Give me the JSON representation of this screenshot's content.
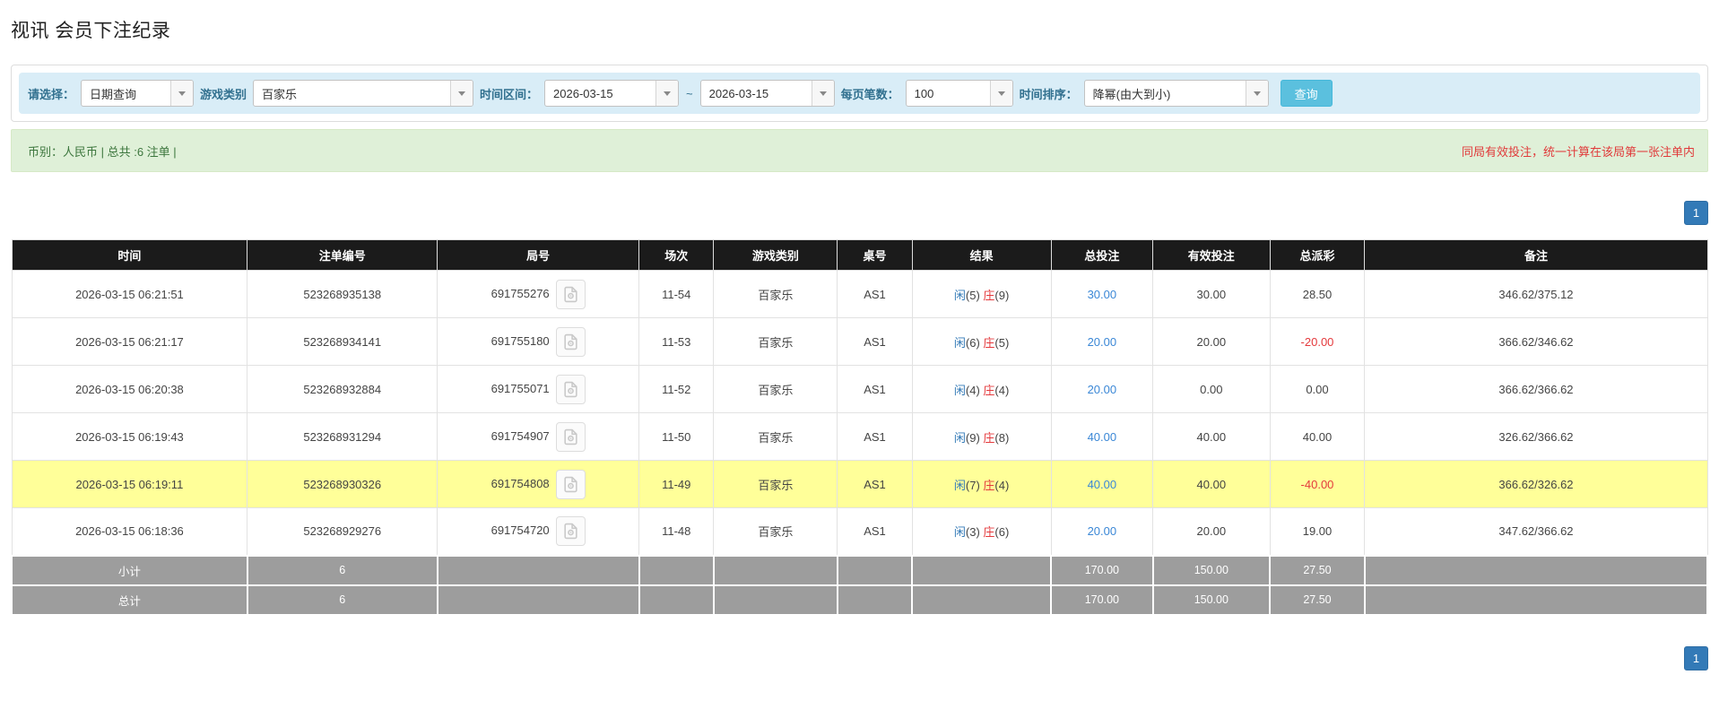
{
  "page": {
    "title": "视讯 会员下注纪录"
  },
  "filters": {
    "select_label": "请选择：",
    "select_value": "日期查询",
    "game_type_label": "游戏类别",
    "game_type_value": "百家乐",
    "time_range_label": "时间区间：",
    "date_from": "2026-03-15",
    "tilde": "~",
    "date_to": "2026-03-15",
    "page_size_label": "每页笔数：",
    "page_size_value": "100",
    "sort_label": "时间排序：",
    "sort_value": "降幂(由大到小)",
    "search_button": "查询"
  },
  "summary": {
    "left": "币别：人民币 | 总共 :6 注单 |",
    "right": "同局有效投注，统一计算在该局第一张注单内"
  },
  "pagination": {
    "page": "1"
  },
  "icons": {
    "combo_arrow": "caret-down-icon",
    "round_cell_icon": "video-file-icon"
  },
  "colors": {
    "filter_bar_bg": "#d9edf7",
    "filter_label": "#31708f",
    "query_button": "#5bc0de",
    "summary_bg": "#dff0d8",
    "summary_text": "#3c763d",
    "notice_red": "#e03a3a",
    "header_bg": "#1b1b1b",
    "highlight_yellow": "#ffff99",
    "player_blue": "#337ab7",
    "banker_red": "#e4393c",
    "link_blue": "#3a87d6",
    "negative_red": "#e4393c",
    "footer_gray": "#9d9d9d",
    "pager_blue": "#337ab7"
  },
  "table": {
    "headers": [
      "时间",
      "注单编号",
      "局号",
      "场次",
      "游戏类别",
      "桌号",
      "结果",
      "总投注",
      "有效投注",
      "总派彩",
      "备注"
    ],
    "rows": [
      {
        "time": "2026-03-15 06:21:51",
        "bet_id": "523268935138",
        "round": "691755276",
        "session": "11-54",
        "game": "百家乐",
        "table_no": "AS1",
        "result": {
          "player": "闲",
          "player_score": "(5)",
          "banker": "庄",
          "banker_score": "(9)"
        },
        "total_bet": "30.00",
        "valid_bet": "30.00",
        "payout": "28.50",
        "remark": "346.62/375.12",
        "highlight": false
      },
      {
        "time": "2026-03-15 06:21:17",
        "bet_id": "523268934141",
        "round": "691755180",
        "session": "11-53",
        "game": "百家乐",
        "table_no": "AS1",
        "result": {
          "player": "闲",
          "player_score": "(6)",
          "banker": "庄",
          "banker_score": "(5)"
        },
        "total_bet": "20.00",
        "valid_bet": "20.00",
        "payout": "-20.00",
        "remark": "366.62/346.62",
        "highlight": false
      },
      {
        "time": "2026-03-15 06:20:38",
        "bet_id": "523268932884",
        "round": "691755071",
        "session": "11-52",
        "game": "百家乐",
        "table_no": "AS1",
        "result": {
          "player": "闲",
          "player_score": "(4)",
          "banker": "庄",
          "banker_score": "(4)"
        },
        "total_bet": "20.00",
        "valid_bet": "0.00",
        "payout": "0.00",
        "remark": "366.62/366.62",
        "highlight": false
      },
      {
        "time": "2026-03-15 06:19:43",
        "bet_id": "523268931294",
        "round": "691754907",
        "session": "11-50",
        "game": "百家乐",
        "table_no": "AS1",
        "result": {
          "player": "闲",
          "player_score": "(9)",
          "banker": "庄",
          "banker_score": "(8)"
        },
        "total_bet": "40.00",
        "valid_bet": "40.00",
        "payout": "40.00",
        "remark": "326.62/366.62",
        "highlight": false
      },
      {
        "time": "2026-03-15 06:19:11",
        "bet_id": "523268930326",
        "round": "691754808",
        "session": "11-49",
        "game": "百家乐",
        "table_no": "AS1",
        "result": {
          "player": "闲",
          "player_score": "(7)",
          "banker": "庄",
          "banker_score": "(4)"
        },
        "total_bet": "40.00",
        "valid_bet": "40.00",
        "payout": "-40.00",
        "remark": "366.62/326.62",
        "highlight": true
      },
      {
        "time": "2026-03-15 06:18:36",
        "bet_id": "523268929276",
        "round": "691754720",
        "session": "11-48",
        "game": "百家乐",
        "table_no": "AS1",
        "result": {
          "player": "闲",
          "player_score": "(3)",
          "banker": "庄",
          "banker_score": "(6)"
        },
        "total_bet": "20.00",
        "valid_bet": "20.00",
        "payout": "19.00",
        "remark": "347.62/366.62",
        "highlight": false
      }
    ],
    "subtotal": {
      "label": "小计",
      "count": "6",
      "total_bet": "170.00",
      "valid_bet": "150.00",
      "payout": "27.50"
    },
    "total": {
      "label": "总计",
      "count": "6",
      "total_bet": "170.00",
      "valid_bet": "150.00",
      "payout": "27.50"
    }
  }
}
